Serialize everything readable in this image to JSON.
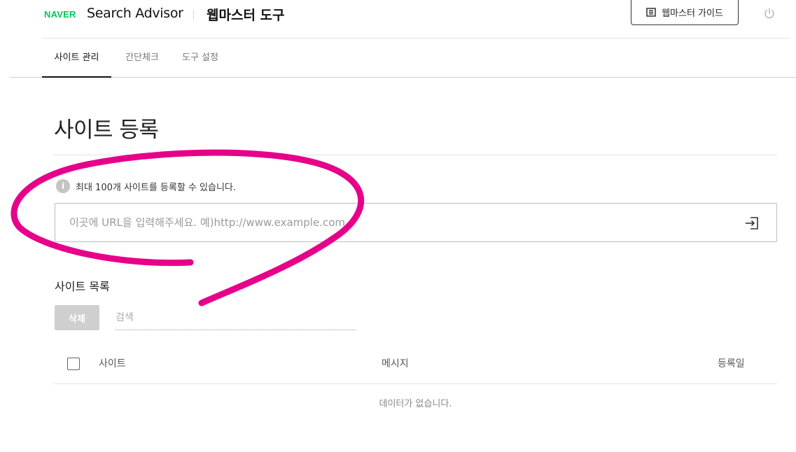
{
  "header": {
    "logo": "NAVER",
    "brand": "Search Advisor",
    "tool_title": "웹마스터 도구",
    "guide_button": "웹마스터 가이드"
  },
  "tabs": [
    {
      "label": "사이트 관리",
      "active": true
    },
    {
      "label": "간단체크",
      "active": false
    },
    {
      "label": "도구 설정",
      "active": false
    }
  ],
  "main": {
    "title": "사이트 등록",
    "notice": "최대 100개 사이트를 등록할 수 있습니다.",
    "url_input": {
      "placeholder": "이곳에 URL을 입력해주세요. 예)http://www.example.com",
      "value": ""
    },
    "site_list": {
      "title": "사이트 목록",
      "delete_button": "삭제",
      "search_placeholder": "검색",
      "columns": [
        "사이트",
        "메시지",
        "등록일"
      ],
      "rows": [],
      "empty_text": "데이터가 없습니다."
    }
  },
  "colors": {
    "brand_green": "#03c75a",
    "annotation": "#e6008a"
  }
}
